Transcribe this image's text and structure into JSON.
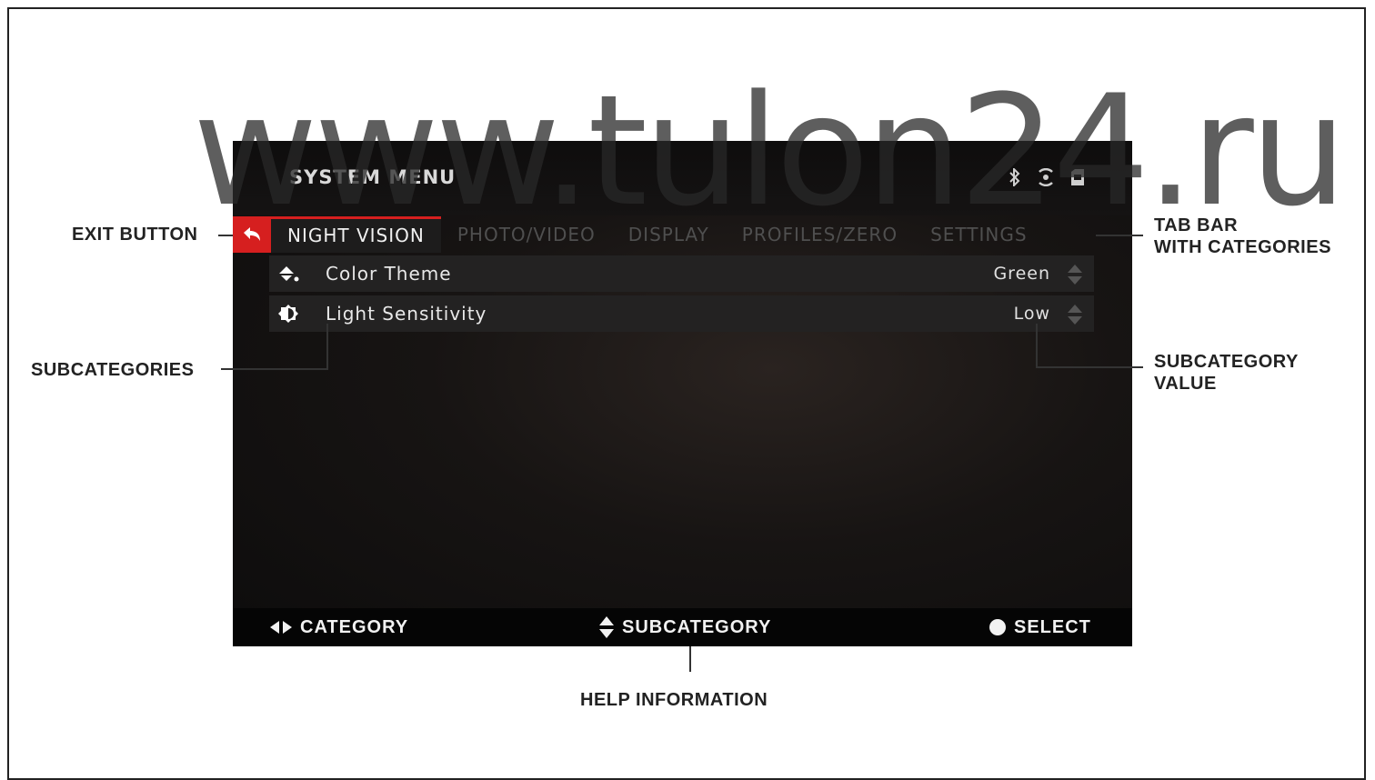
{
  "watermark": "www.tulon24.ru",
  "screen": {
    "title": "SYSTEM MENU",
    "status_icons": [
      "bluetooth-icon",
      "wifi-icon",
      "sd-card-icon"
    ],
    "tabs": [
      {
        "label": "NIGHT VISION",
        "active": true
      },
      {
        "label": "PHOTO/VIDEO",
        "active": false
      },
      {
        "label": "DISPLAY",
        "active": false
      },
      {
        "label": "PROFILES/ZERO",
        "active": false
      },
      {
        "label": "SETTINGS",
        "active": false
      }
    ],
    "subcategories": [
      {
        "icon": "paint-bucket-icon",
        "label": "Color Theme",
        "value": "Green"
      },
      {
        "icon": "brightness-icon",
        "label": "Light Sensitivity",
        "value": "Low"
      }
    ],
    "help": {
      "category": "CATEGORY",
      "subcategory": "SUBCATEGORY",
      "select": "SELECT"
    }
  },
  "callouts": {
    "exit_button": "EXIT BUTTON",
    "tab_bar_line1": "TAB BAR",
    "tab_bar_line2": "WITH CATEGORIES",
    "subcategories": "SUBCATEGORIES",
    "subcategory_value_line1": "SUBCATEGORY",
    "subcategory_value_line2": "VALUE",
    "help_information": "HELP INFORMATION"
  },
  "colors": {
    "accent": "#d61f1f",
    "screen_bg": "#141212",
    "active_text": "#f0f0f0",
    "inactive_text": "#4f4f4f"
  }
}
